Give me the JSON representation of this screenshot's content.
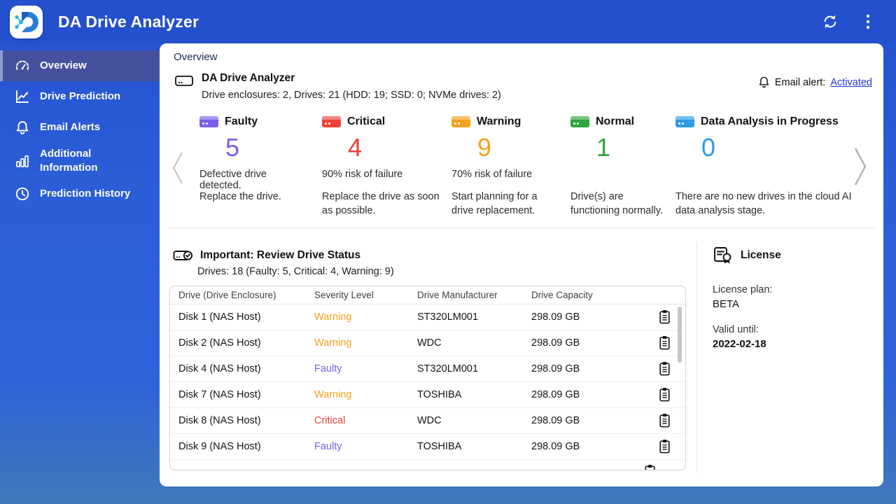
{
  "topbar": {
    "app_title": "DA Drive Analyzer"
  },
  "sidebar": {
    "items": [
      {
        "label": "Overview"
      },
      {
        "label": "Drive Prediction"
      },
      {
        "label": "Email Alerts"
      },
      {
        "label": "Additional Information"
      },
      {
        "label": "Prediction History"
      }
    ]
  },
  "page": {
    "title": "Overview",
    "header": {
      "title": "DA Drive Analyzer",
      "subtitle": "Drive enclosures: 2, Drives: 21 (HDD: 19; SSD: 0; NVMe drives: 2)",
      "email_alert_label": "Email alert:",
      "email_alert_link": "Activated"
    },
    "status_cards": [
      {
        "label": "Faulty",
        "count": "5",
        "color": "#7a5ee8",
        "line1": "Defective drive detected.",
        "line2": "Replace the drive."
      },
      {
        "label": "Critical",
        "count": "4",
        "color": "#ee4138",
        "line1": "90% risk of failure",
        "line2": "Replace the drive as soon as possible."
      },
      {
        "label": "Warning",
        "count": "9",
        "color": "#f4a11d",
        "line1": "70% risk of failure",
        "line2": "Start planning for a drive replacement."
      },
      {
        "label": "Normal",
        "count": "1",
        "color": "#2fa33c",
        "line1": "",
        "line2": "Drive(s) are functioning normally."
      },
      {
        "label": "Data Analysis in Progress",
        "count": "0",
        "color": "#2d9be8",
        "line1": "",
        "line2": "There are no new drives in the cloud AI data analysis stage."
      }
    ],
    "important": {
      "title": "Important: Review Drive Status",
      "subtitle": "Drives: 18 (Faulty: 5, Critical: 4, Warning: 9)",
      "table": {
        "columns": [
          "Drive (Drive Enclosure)",
          "Severity Level",
          "Drive Manufacturer",
          "Drive Capacity"
        ],
        "rows": [
          {
            "drive": "Disk 1 (NAS Host)",
            "severity": "Warning",
            "severity_color": "#f4a11d",
            "manufacturer": "ST320LM001",
            "capacity": "298.09 GB"
          },
          {
            "drive": "Disk 2 (NAS Host)",
            "severity": "Warning",
            "severity_color": "#f4a11d",
            "manufacturer": "WDC",
            "capacity": "298.09 GB"
          },
          {
            "drive": "Disk 4 (NAS Host)",
            "severity": "Faulty",
            "severity_color": "#7a5ee8",
            "manufacturer": "ST320LM001",
            "capacity": "298.09 GB"
          },
          {
            "drive": "Disk 7 (NAS Host)",
            "severity": "Warning",
            "severity_color": "#f4a11d",
            "manufacturer": "TOSHIBA",
            "capacity": "298.09 GB"
          },
          {
            "drive": "Disk 8 (NAS Host)",
            "severity": "Critical",
            "severity_color": "#ee4138",
            "manufacturer": "WDC",
            "capacity": "298.09 GB"
          },
          {
            "drive": "Disk 9 (NAS Host)",
            "severity": "Faulty",
            "severity_color": "#7a5ee8",
            "manufacturer": "TOSHIBA",
            "capacity": "298.09 GB"
          }
        ]
      }
    },
    "license": {
      "title": "License",
      "plan_label": "License plan:",
      "plan": "BETA",
      "valid_label": "Valid until:",
      "valid": "2022-02-18"
    }
  },
  "colors": {
    "topbar": "#2450cd",
    "sidebar_active": "#45519f",
    "link": "#2336d4"
  }
}
